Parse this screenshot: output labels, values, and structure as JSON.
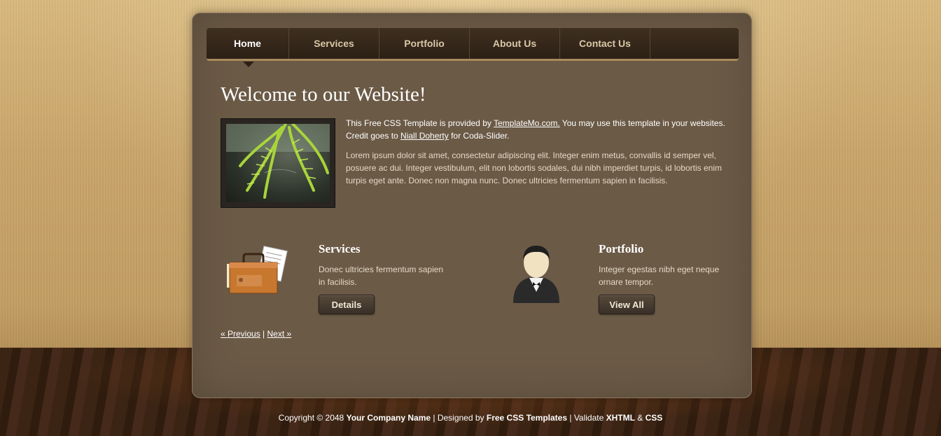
{
  "nav": {
    "items": [
      "Home",
      "Services",
      "Portfolio",
      "About Us",
      "Contact Us"
    ],
    "active": "Home"
  },
  "main": {
    "title": "Welcome to our Website!",
    "intro": {
      "prefix": "This Free CSS Template is provided by ",
      "link1": "TemplateMo.com.",
      "middle": " You may use this template in your websites. Credit goes to ",
      "link2": "Niall Doherty",
      "suffix": " for Coda-Slider."
    },
    "lorem": "Lorem ipsum dolor sit amet, consectetur adipiscing elit. Integer enim metus, convallis id semper vel, posuere ac dui. Integer vestibulum, elit non lobortis sodales, dui nibh imperdiet turpis, id lobortis enim turpis eget ante. Donec non magna nunc. Donec ultricies fermentum sapien in facilisis."
  },
  "features": [
    {
      "title": "Services",
      "text": "Donec ultricies fermentum sapien in facilisis.",
      "button": "Details",
      "icon": "briefcase-icon"
    },
    {
      "title": "Portfolio",
      "text": "Integer egestas nibh eget neque ornare tempor.",
      "button": "View All",
      "icon": "user-icon"
    }
  ],
  "pager": {
    "prev": "« Previous",
    "sep": "|",
    "next": "Next »"
  },
  "footer": {
    "prefix": "Copyright © 2048 ",
    "company": "Your Company Name",
    "designed": " | Designed by ",
    "designer": "Free CSS Templates",
    "validate": " | Validate ",
    "xhtml": "XHTML",
    "amp": " & ",
    "css": "CSS"
  },
  "colors": {
    "panel": "#6b5a46",
    "nav": "#2c2015",
    "accent": "#a98a5c"
  }
}
